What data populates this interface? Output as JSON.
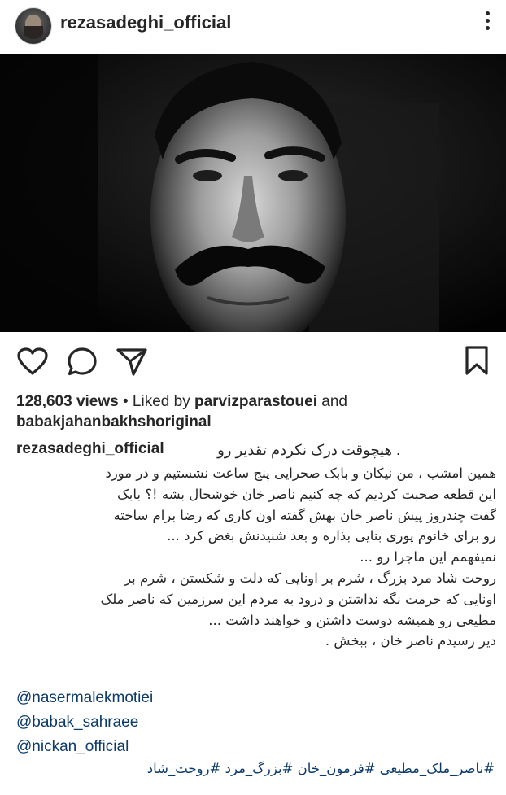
{
  "post": {
    "username": "rezasadeghi_official",
    "views": "128,603 views",
    "liked_by_prefix": "• Liked by",
    "liked_by_user1": "parvizparastouei",
    "liked_by_and": "and",
    "liked_by_user2": "babakjahanbakhshoriginal"
  },
  "caption": {
    "username": "rezasadeghi_official",
    "first_line": ". هیچوقت درک نکردم تقدیر رو",
    "lines": [
      "همین امشب ، من نیکان و بابک صحرایی پنج ساعت نشستیم و در مورد",
      "این قطعه صحبت کردیم که چه کنیم ناصر خان خوشحال بشه !؟ بابک",
      "گفت چندروز پیش ناصر خان بهش گفته اون کاری که رضا برام ساخته",
      "رو برای خانوم پوری بنایی بذاره و بعد شنیدنش بغض کرد ...",
      "نمیفهمم این ماجرا رو ...",
      "روحت شاد مرد بزرگ ، شرم بر اونایی که دلت و شکستن ، شرم بر",
      "اونایی که حرمت نگه نداشتن و درود به مردم این سرزمین که ناصر ملک",
      "مطیعی رو همیشه دوست داشتن و خواهند داشت ...",
      "دیر رسیدم ناصر خان ، ببخش ."
    ],
    "mentions": [
      "@nasermalekmotiei",
      "@babak_sahraee",
      "@nickan_official"
    ],
    "hashtags": "#ناصر_ملک_مطیعی #فرمون_خان #بزرگ_مرد #روحت_شاد"
  },
  "icons": [
    "more-icon",
    "heart-icon",
    "comment-icon",
    "share-icon",
    "bookmark-icon"
  ]
}
